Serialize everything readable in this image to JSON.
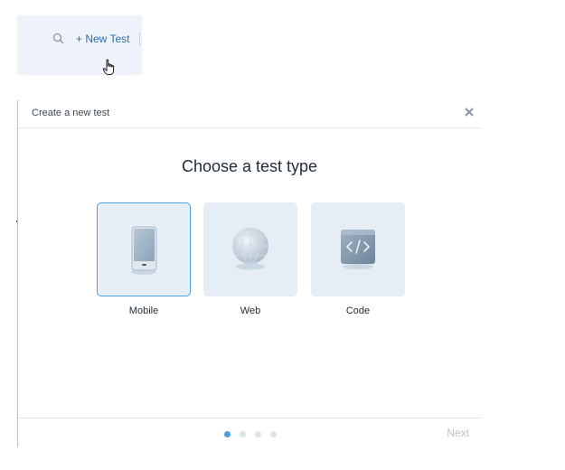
{
  "toolbar": {
    "search_icon": "search-icon",
    "new_test_label": "+ New Test",
    "cursor_icon": "pointer-hand-icon"
  },
  "modal": {
    "title": "Create a new test",
    "close_icon": "close-icon",
    "heading": "Choose a test type",
    "options": [
      {
        "label": "Mobile",
        "icon": "mobile-device-icon",
        "selected": true
      },
      {
        "label": "Web",
        "icon": "globe-icon",
        "selected": false
      },
      {
        "label": "Code",
        "icon": "code-icon",
        "selected": false
      }
    ],
    "pagination": {
      "total_steps": 4,
      "current_step": 1
    },
    "next_label": "Next"
  },
  "colors": {
    "accent": "#4a9fe0",
    "card_bg": "#e6edf5",
    "toolbar_bg": "#eef3f9",
    "link": "#2f6fae",
    "disabled_text": "#b9c2cc"
  }
}
